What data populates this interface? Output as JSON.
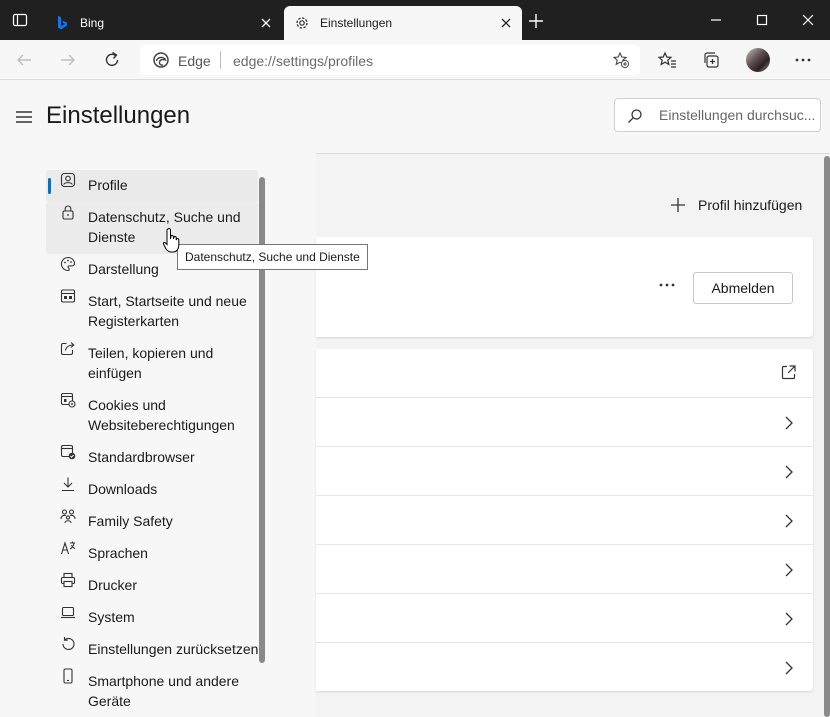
{
  "colors": {
    "accent": "#0f6cbd",
    "bing_icon": "#1a73e8",
    "tabbar_bg": "#202020"
  },
  "tabs": [
    {
      "title": "Bing",
      "icon": "bing-icon",
      "active": false
    },
    {
      "title": "Einstellungen",
      "icon": "gear-icon",
      "active": true
    }
  ],
  "address_bar": {
    "brand": "Edge",
    "url": "edge://settings/profiles"
  },
  "sidebar": {
    "title": "Einstellungen",
    "items": [
      {
        "label": "Profile",
        "icon": "profile-icon"
      },
      {
        "label": "Datenschutz, Suche und Dienste",
        "icon": "lock-icon"
      },
      {
        "label": "Darstellung",
        "icon": "palette-icon"
      },
      {
        "label": "Start, Startseite und neue Registerkarten",
        "icon": "start-page-icon"
      },
      {
        "label": "Teilen, kopieren und einfügen",
        "icon": "share-icon"
      },
      {
        "label": "Cookies und Websiteberechtigungen",
        "icon": "cookies-icon"
      },
      {
        "label": "Standardbrowser",
        "icon": "default-browser-icon"
      },
      {
        "label": "Downloads",
        "icon": "download-icon"
      },
      {
        "label": "Family Safety",
        "icon": "family-icon"
      },
      {
        "label": "Sprachen",
        "icon": "languages-icon"
      },
      {
        "label": "Drucker",
        "icon": "printer-icon"
      },
      {
        "label": "System",
        "icon": "laptop-icon"
      },
      {
        "label": "Einstellungen zurücksetzen",
        "icon": "reset-icon"
      },
      {
        "label": "Smartphone und andere Geräte",
        "icon": "phone-icon"
      }
    ]
  },
  "main": {
    "search_placeholder": "Einstellungen durchsuc...",
    "add_profile_label": "Profil hinzufügen",
    "signout_label": "Abmelden"
  },
  "tooltip": "Datenschutz, Suche und Dienste"
}
